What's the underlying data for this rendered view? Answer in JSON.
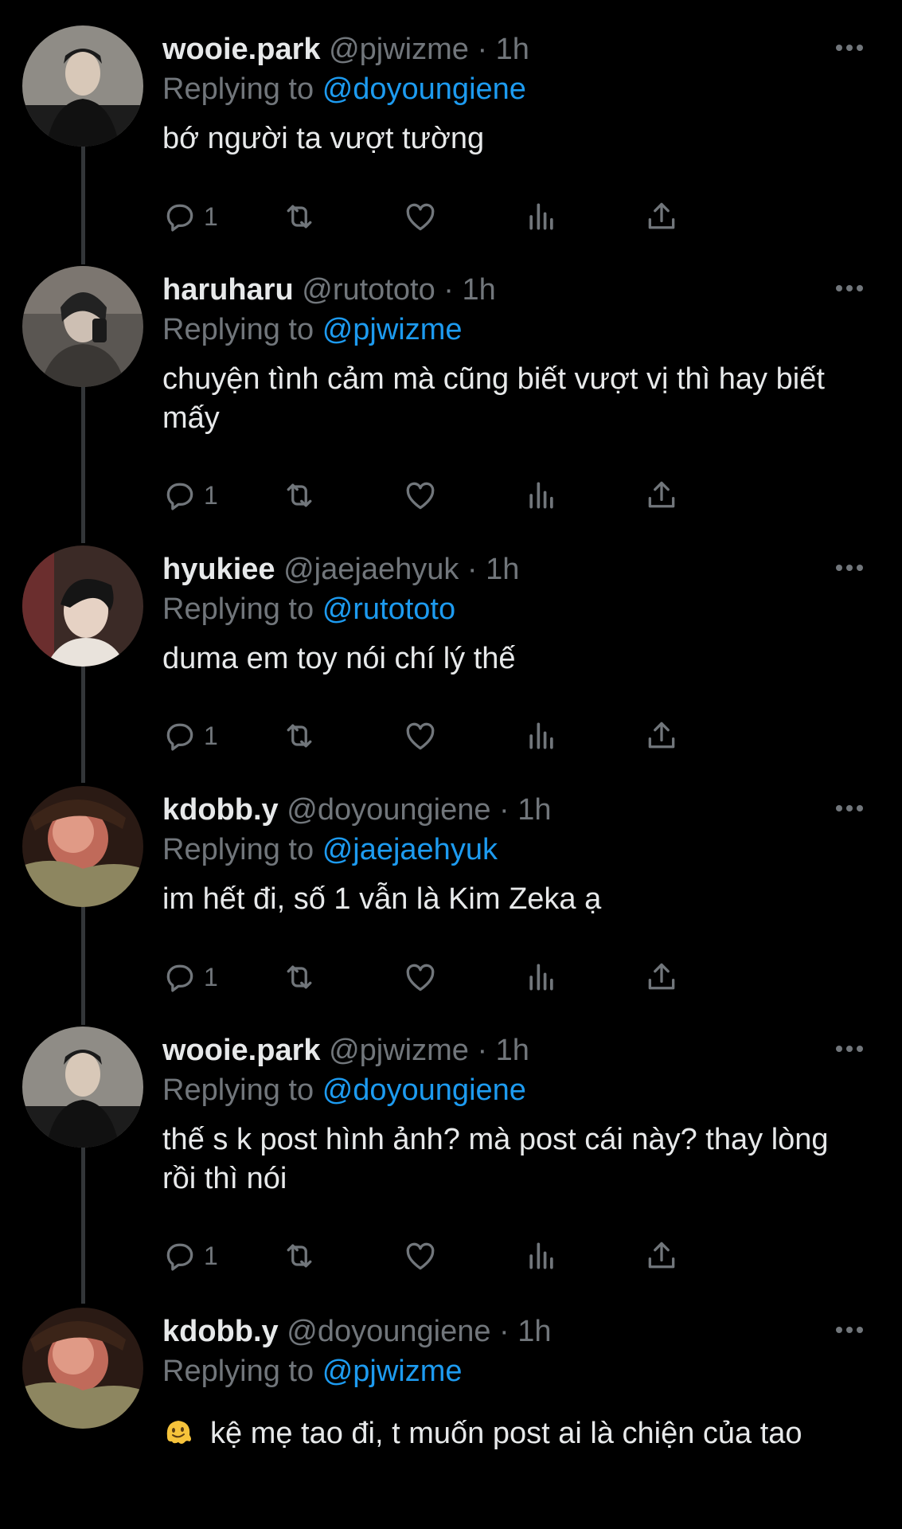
{
  "colors": {
    "background": "#000000",
    "text": "#e7e9ea",
    "muted": "#71767b",
    "accent": "#1d9bf0",
    "thread_line": "#333639"
  },
  "icons": {
    "reply": "reply-icon",
    "retweet": "retweet-icon",
    "like": "heart-icon",
    "views": "views-icon",
    "share": "share-icon",
    "more": "more-icon"
  },
  "tweets": [
    {
      "name": "wooie.park",
      "handle": "@pjwizme",
      "dot": "·",
      "time": "1h",
      "replying_label": "Replying to",
      "reply_to": "@doyoungiene",
      "text": "bớ người ta vượt tường",
      "reply_count": "1",
      "avatar": "avatar-a"
    },
    {
      "name": "haruharu",
      "handle": "@rutototo",
      "dot": "·",
      "time": "1h",
      "replying_label": "Replying to",
      "reply_to": "@pjwizme",
      "text": "chuyện tình cảm mà cũng biết vượt vị thì hay biết mấy",
      "reply_count": "1",
      "avatar": "avatar-b"
    },
    {
      "name": "hyukiee",
      "handle": "@jaejaehyuk",
      "dot": "·",
      "time": "1h",
      "replying_label": "Replying to",
      "reply_to": "@rutototo",
      "text": "duma em toy nói chí lý thế",
      "reply_count": "1",
      "avatar": "avatar-c"
    },
    {
      "name": "kdobb.y",
      "handle": "@doyoungiene",
      "dot": "·",
      "time": "1h",
      "replying_label": "Replying to",
      "reply_to": "@jaejaehyuk",
      "text": "im hết đi, số 1 vẫn là Kim Zeka ạ",
      "reply_count": "1",
      "avatar": "avatar-d"
    },
    {
      "name": "wooie.park",
      "handle": "@pjwizme",
      "dot": "·",
      "time": "1h",
      "replying_label": "Replying to",
      "reply_to": "@doyoungiene",
      "text": "thế s k post hình ảnh? mà post cái này? thay lòng rồi thì nói",
      "reply_count": "1",
      "avatar": "avatar-a"
    },
    {
      "name": "kdobb.y",
      "handle": "@doyoungiene",
      "dot": "·",
      "time": "1h",
      "replying_label": "Replying to",
      "reply_to": "@pjwizme",
      "text": "kệ mẹ tao đi, t muốn post ai là chiện của tao",
      "emoji": "melting-face-emoji",
      "avatar": "avatar-d"
    }
  ]
}
